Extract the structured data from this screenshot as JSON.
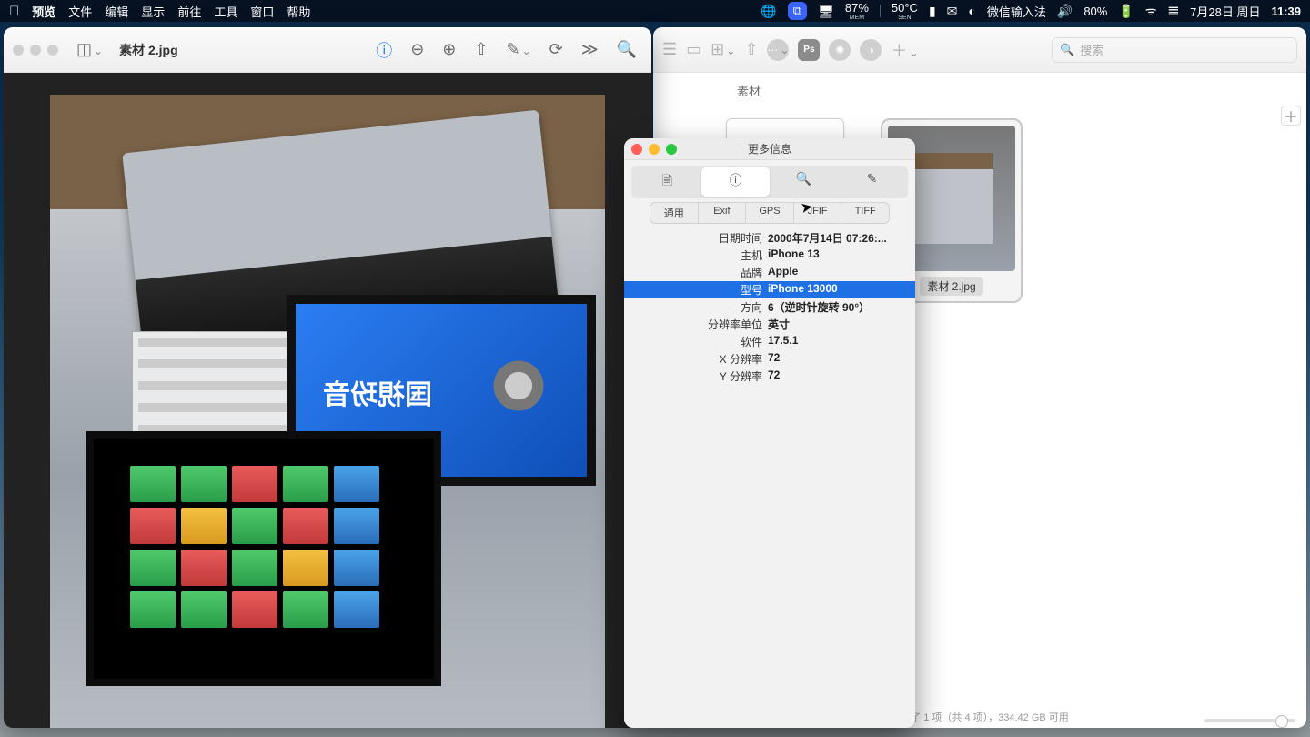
{
  "menubar": {
    "app": "预览",
    "items": [
      "文件",
      "编辑",
      "显示",
      "前往",
      "工具",
      "窗口",
      "帮助"
    ],
    "mem_pct": "87%",
    "mem_lbl": "MEM",
    "temp": "50°C",
    "temp_lbl": "SEN",
    "ime": "微信输入法",
    "battery": "80%",
    "date": "7月28日 周日",
    "time": "11:39"
  },
  "preview": {
    "title": "素材 2.jpg",
    "photo_text": "国視玢音"
  },
  "finder": {
    "folder": "素材",
    "search_ph": "搜索",
    "selected_name": "素材 2.jpg",
    "status": "选择了 1 项（共 4 项），334.42 GB 可用"
  },
  "inspector": {
    "title": "更多信息",
    "tabs2": [
      "通用",
      "Exif",
      "GPS",
      "JFIF",
      "TIFF"
    ],
    "rows": [
      {
        "k": "日期时间",
        "v": "2000年7月14日 07:26:..."
      },
      {
        "k": "主机",
        "v": "iPhone 13"
      },
      {
        "k": "品牌",
        "v": "Apple"
      },
      {
        "k": "型号",
        "v": "iPhone 13000"
      },
      {
        "k": "方向",
        "v": "6（逆时针旋转 90°）"
      },
      {
        "k": "分辨率单位",
        "v": "英寸"
      },
      {
        "k": "软件",
        "v": "17.5.1"
      },
      {
        "k": "X 分辨率",
        "v": "72"
      },
      {
        "k": "Y 分辨率",
        "v": "72"
      }
    ],
    "selected_index": 3
  }
}
